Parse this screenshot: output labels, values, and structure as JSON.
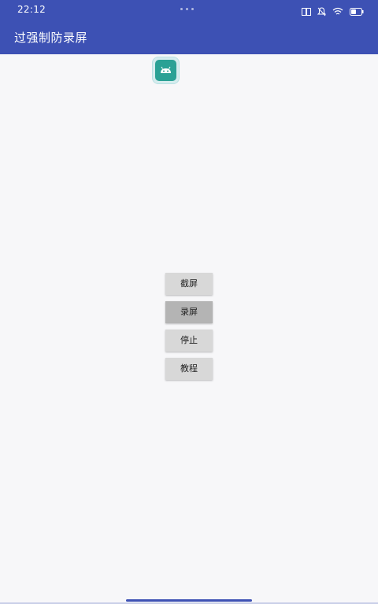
{
  "status_bar": {
    "time": "22:12",
    "icons": [
      "book-icon",
      "mute-icon",
      "wifi-icon",
      "battery-icon"
    ]
  },
  "app_bar": {
    "title": "过强制防录屏",
    "color": "#3d51b4"
  },
  "app_icon": {
    "name": "android-app-icon",
    "color": "#2aa195"
  },
  "buttons": {
    "screenshot": "截屏",
    "record": "录屏",
    "stop": "停止",
    "tutorial": "教程"
  }
}
